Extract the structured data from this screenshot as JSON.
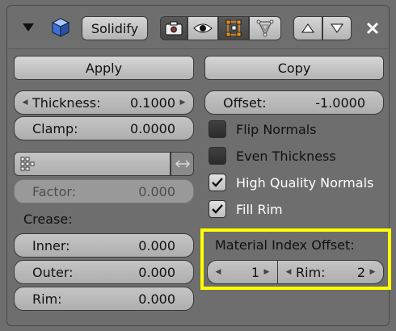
{
  "header": {
    "modifier_name": "Solidify",
    "icons": [
      "collapse-triangle-icon",
      "cube-icon",
      "camera-icon",
      "eye-icon",
      "edit-mode-icon",
      "cage-icon",
      "move-up-icon",
      "move-down-icon",
      "close-icon"
    ]
  },
  "buttons": {
    "apply": "Apply",
    "copy": "Copy"
  },
  "fields": {
    "thickness": {
      "label": "Thickness:",
      "value": "0.1000"
    },
    "clamp": {
      "label": "Clamp:",
      "value": "0.0000"
    },
    "offset": {
      "label": "Offset:",
      "value": "-1.0000"
    },
    "factor": {
      "label": "Factor:",
      "value": "0.000"
    }
  },
  "checkboxes": [
    {
      "label": "Flip Normals",
      "checked": false
    },
    {
      "label": "Even Thickness",
      "checked": false
    },
    {
      "label": "High Quality Normals",
      "checked": true
    },
    {
      "label": "Fill Rim",
      "checked": true
    }
  ],
  "crease": {
    "heading": "Crease:",
    "inner": {
      "label": "Inner:",
      "value": "0.000"
    },
    "outer": {
      "label": "Outer:",
      "value": "0.000"
    },
    "rim": {
      "label": "Rim:",
      "value": "0.000"
    }
  },
  "material_offset": {
    "heading": "Material Index Offset:",
    "value": "1",
    "rim_label": "Rim:",
    "rim_value": "2"
  },
  "colors": {
    "highlight": "#ffff00",
    "panel": "#6e6e6e"
  }
}
